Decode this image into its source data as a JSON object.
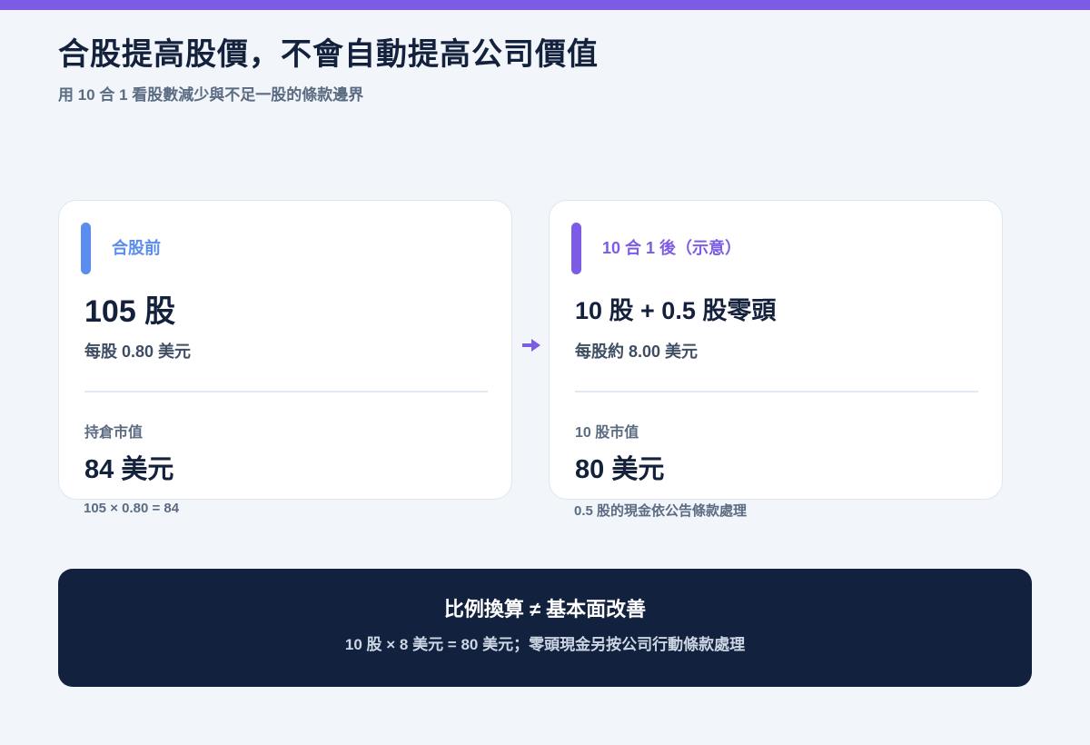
{
  "header": {
    "title": "合股提高股價，不會自動提高公司價值",
    "subtitle": "用 10 合 1 看股數減少與不足一股的條款邊界"
  },
  "before": {
    "label": "合股前",
    "shares": "105 股",
    "price": "每股 0.80 美元",
    "value_label": "持倉市值",
    "value": "84 美元",
    "note": "105 × 0.80 = 84"
  },
  "after": {
    "label": "10 合 1 後（示意）",
    "shares": "10 股 + 0.5 股零頭",
    "price": "每股約 8.00 美元",
    "value_label": "10 股市值",
    "value": "80 美元",
    "note": "0.5 股的現金依公告條款處理"
  },
  "summary": {
    "title": "比例換算 ≠ 基本面改善",
    "text": "10 股 × 8 美元 = 80 美元；零頭現金另按公司行動條款處理"
  },
  "colors": {
    "before_accent": "#5b8def",
    "after_accent": "#7c5ce6",
    "summary_bg": "#12213d"
  },
  "icons": {
    "flow": "arrow-right-icon"
  }
}
